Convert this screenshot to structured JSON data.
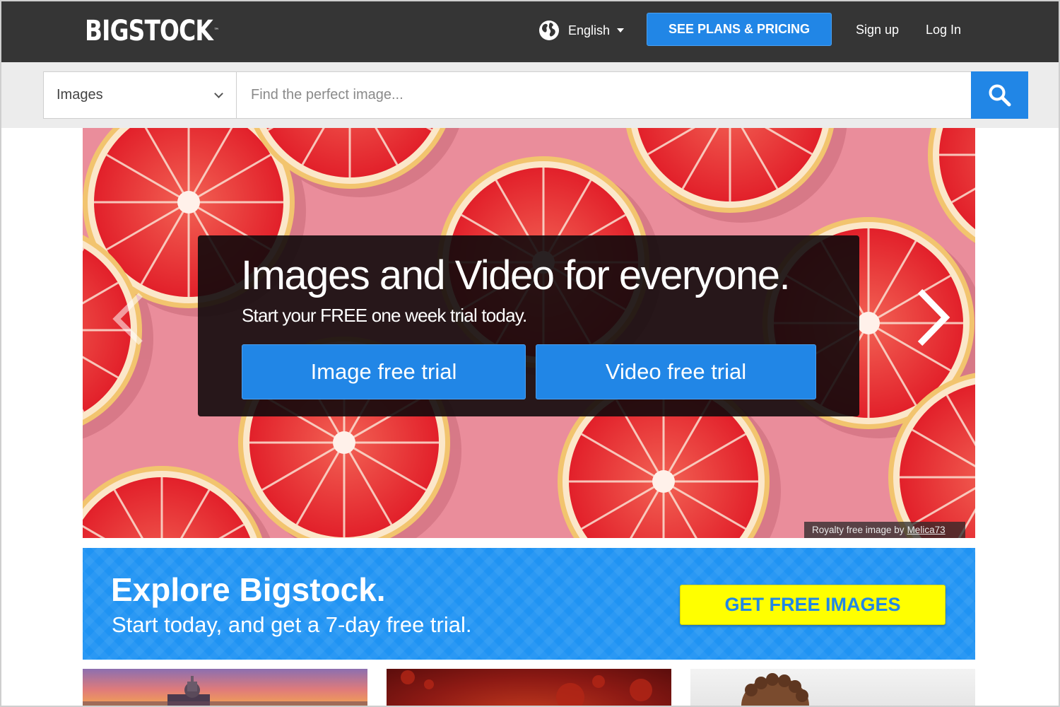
{
  "header": {
    "logo_text": "BIGSTOCK",
    "logo_tm": "™",
    "language": "English",
    "plans_button": "SEE PLANS & PRICING",
    "signup": "Sign up",
    "login": "Log In"
  },
  "search": {
    "type_selected": "Images",
    "placeholder": "Find the perfect image..."
  },
  "hero": {
    "title": "Images and Video for everyone.",
    "subtitle": "Start your FREE one week trial today.",
    "image_trial": "Image free trial",
    "video_trial": "Video free trial",
    "credit_prefix": "Royalty free image by",
    "credit_author": "Melica73"
  },
  "explore": {
    "title": "Explore Bigstock.",
    "subtitle": "Start today, and get a 7-day free trial.",
    "button": "GET FREE IMAGES"
  },
  "colors": {
    "topbar": "#353535",
    "accent_blue": "#2186e6",
    "banner_blue": "#1f93f3",
    "cta_yellow": "#ffff00",
    "hero_pink": "#ea8d9b",
    "grapefruit_red": "#e8262c"
  },
  "icons": {
    "globe": "globe-icon",
    "caret": "caret-down-icon",
    "dropdown": "chevron-down-icon",
    "search": "search-icon",
    "prev": "chevron-left-icon",
    "next": "chevron-right-icon"
  }
}
